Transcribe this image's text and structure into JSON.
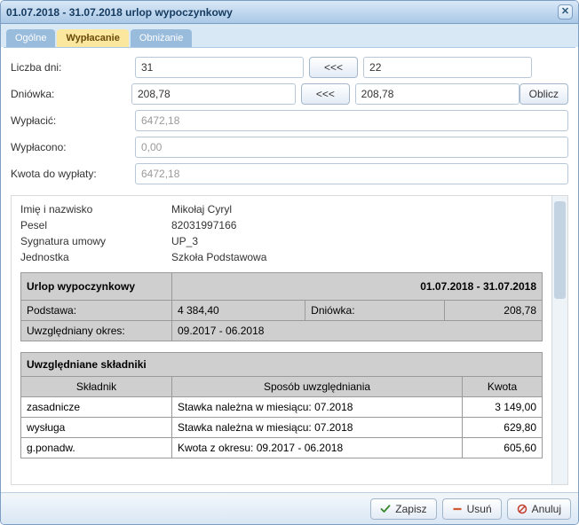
{
  "window_title": "01.07.2018 - 31.07.2018 urlop wypoczynkowy",
  "tabs": {
    "general": "Ogólne",
    "payout": "Wypłacanie",
    "lowering": "Obniżanie"
  },
  "form": {
    "days_label": "Liczba dni:",
    "days_value": "31",
    "days_alt_value": "22",
    "rate_label": "Dniówka:",
    "rate_value": "208,78",
    "rate_alt_value": "208,78",
    "calc_button": "Oblicz",
    "transfer_button": "<<<",
    "to_pay_label": "Wypłacić:",
    "to_pay_value": "6472,18",
    "paid_label": "Wypłacono:",
    "paid_value": "0,00",
    "remaining_label": "Kwota do wypłaty:",
    "remaining_value": "6472,18"
  },
  "info": {
    "name_label": "Imię i nazwisko",
    "name_value": "Mikołaj Cyryl",
    "pesel_label": "Pesel",
    "pesel_value": "82031997166",
    "contract_label": "Sygnatura umowy",
    "contract_value": "UP_3",
    "unit_label": "Jednostka",
    "unit_value": "Szkoła Podstawowa"
  },
  "summary": {
    "title": "Urlop wypoczynkowy",
    "period": "01.07.2018 - 31.07.2018",
    "base_label": "Podstawa:",
    "base_value": "4 384,40",
    "rate_label": "Dniówka:",
    "rate_value": "208,78",
    "range_label": "Uwzględniany okres:",
    "range_value": "09.2017 - 06.2018"
  },
  "components": {
    "section_title": "Uwzględniane składniki",
    "col_component": "Składnik",
    "col_method": "Sposób uwzględniania",
    "col_amount": "Kwota",
    "rows": [
      {
        "name": "zasadnicze",
        "method": "Stawka należna w miesiącu: 07.2018",
        "amount": "3 149,00"
      },
      {
        "name": "wysługa",
        "method": "Stawka należna w miesiącu: 07.2018",
        "amount": "629,80"
      },
      {
        "name": "g.ponadw.",
        "method": "Kwota z okresu: 09.2017 - 06.2018",
        "amount": "605,60"
      }
    ]
  },
  "buttons": {
    "save": "Zapisz",
    "delete": "Usuń",
    "cancel": "Anuluj"
  }
}
